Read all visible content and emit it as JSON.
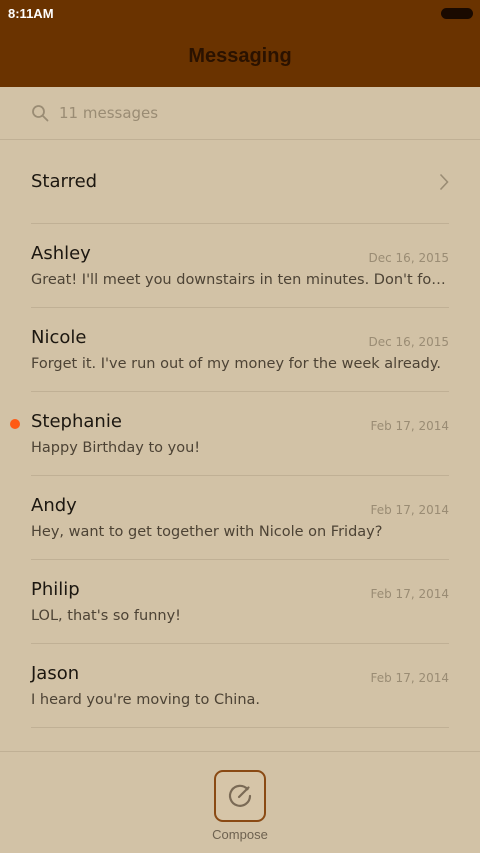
{
  "status_bar": {
    "time": "8:11AM"
  },
  "header": {
    "title": "Messaging"
  },
  "search": {
    "text": "11 messages",
    "icon": "search-icon"
  },
  "starred": {
    "label": "Starred",
    "icon": "chevron-right-icon"
  },
  "conversations": [
    {
      "name": "Ashley",
      "date": "Dec 16, 2015",
      "preview": "Great! I'll meet you downstairs in ten minutes. Don't forget to bring the tickets!",
      "unread": false
    },
    {
      "name": "Nicole",
      "date": "Dec 16, 2015",
      "preview": "Forget it. I've run out of my money for the week already.",
      "unread": false
    },
    {
      "name": "Stephanie",
      "date": "Feb 17, 2014",
      "preview": "Happy Birthday to you!",
      "unread": true
    },
    {
      "name": "Andy",
      "date": "Feb 17, 2014",
      "preview": "Hey, want to get together with Nicole on Friday?",
      "unread": false
    },
    {
      "name": "Philip",
      "date": "Feb 17, 2014",
      "preview": "LOL, that's so funny!",
      "unread": false
    },
    {
      "name": "Jason",
      "date": "Feb 17, 2014",
      "preview": "I heard you're moving to China.",
      "unread": false
    }
  ],
  "compose": {
    "label": "Compose",
    "icon": "compose-icon"
  },
  "colors": {
    "header_bg": "#6a3300",
    "body_bg": "#d2c2a6",
    "unread_dot": "#ff5a14",
    "compose_border": "#8a4a14"
  }
}
